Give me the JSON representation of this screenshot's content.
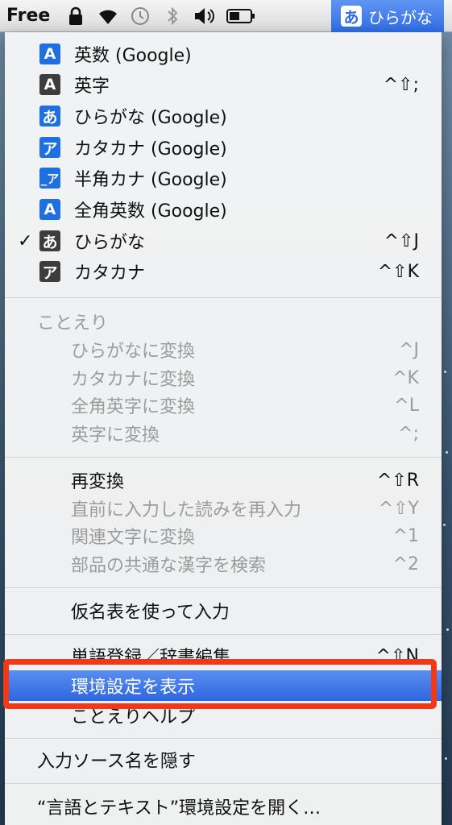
{
  "menubar": {
    "app_name": "Free",
    "input_source_badge": "あ",
    "input_source_label": "ひらがな",
    "icons": [
      "lock-icon",
      "wifi-icon",
      "time-machine-icon",
      "bluetooth-icon",
      "volume-icon",
      "battery-icon"
    ]
  },
  "colors": {
    "highlight": "#2d66e0",
    "annotation": "#f03a17",
    "source_icon_blue": "#1e6fe0",
    "source_icon_gray": "#3d3d3d"
  },
  "input_sources": [
    {
      "icon": "A",
      "label": "英数 (Google)",
      "shortcut": "",
      "checked": false
    },
    {
      "icon": "A",
      "label": "英字",
      "shortcut": "^⇧;",
      "checked": false
    },
    {
      "icon": "あ",
      "label": "ひらがな (Google)",
      "shortcut": "",
      "checked": false
    },
    {
      "icon": "ア",
      "label": "カタカナ (Google)",
      "shortcut": "",
      "checked": false
    },
    {
      "icon": "_ア",
      "label": "半角カナ (Google)",
      "shortcut": "",
      "checked": false
    },
    {
      "icon": "A",
      "label": "全角英数 (Google)",
      "shortcut": "",
      "checked": false
    },
    {
      "icon": "あ",
      "label": "ひらがな",
      "shortcut": "^⇧J",
      "checked": true
    },
    {
      "icon": "ア",
      "label": "カタカナ",
      "shortcut": "^⇧K",
      "checked": false
    }
  ],
  "kotoeri": {
    "header": "ことえり",
    "conversions": [
      {
        "label": "ひらがなに変換",
        "shortcut": "^J"
      },
      {
        "label": "カタカナに変換",
        "shortcut": "^K"
      },
      {
        "label": "全角英字に変換",
        "shortcut": "^L"
      },
      {
        "label": "英字に変換",
        "shortcut": "^;"
      }
    ],
    "reconvert": [
      {
        "label": "再変換",
        "shortcut": "^⇧R",
        "enabled": true
      },
      {
        "label": "直前に入力した読みを再入力",
        "shortcut": "^⇧Y",
        "enabled": false
      },
      {
        "label": "関連文字に変換",
        "shortcut": "^1",
        "enabled": false
      },
      {
        "label": "部品の共通な漢字を検索",
        "shortcut": "^2",
        "enabled": false
      }
    ],
    "kana_table": "仮名表を使って入力",
    "word_register": "単語登録／辞書編集",
    "word_register_shortcut": "^⇧N",
    "preferences": "環境設定を表示",
    "help": "ことえりヘルプ"
  },
  "hide_source_names": "入力ソース名を隠す",
  "open_prefs": "“言語とテキスト”環境設定を開く…"
}
